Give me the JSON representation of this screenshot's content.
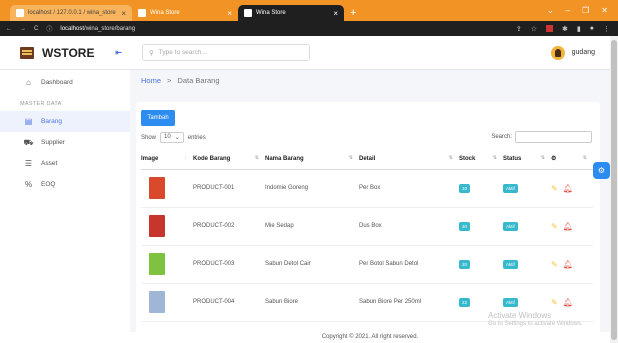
{
  "browser": {
    "tabs": [
      {
        "label": "localhost / 127.0.0.1 / wina_store"
      },
      {
        "label": "Wina Store"
      },
      {
        "label": "Wina Store"
      }
    ],
    "url_prefix": "localhost",
    "url_path": "/wina_store/barang"
  },
  "app": {
    "brand": "WSTORE",
    "search_placeholder": "Type to search...",
    "username": "gudang"
  },
  "sidebar": {
    "dashboard": "Dashboard",
    "section": "MASTER DATA",
    "items": [
      {
        "label": "Barang"
      },
      {
        "label": "Supplier"
      },
      {
        "label": "Asset"
      },
      {
        "label": "EOQ"
      }
    ]
  },
  "breadcrumb": {
    "home": "Home",
    "sep": ">",
    "current": "Data Barang"
  },
  "table": {
    "add_button": "Tambah",
    "show": "Show",
    "entries_value": "10",
    "entries": "entries",
    "search_label": "Search:",
    "headers": [
      "Image",
      "Kode Barang",
      "Nama Barang",
      "Detail",
      "Stock",
      "Status"
    ],
    "rows": [
      {
        "code": "PRODUCT-001",
        "name": "Indomie Goreng",
        "detail": "Per Box",
        "stock": "10",
        "status": "Aktif",
        "thumb_color": "#d9492b"
      },
      {
        "code": "PRODUCT-002",
        "name": "Mie Sedap",
        "detail": "Dus Box",
        "stock": "20",
        "status": "Aktif",
        "thumb_color": "#c7362d"
      },
      {
        "code": "PRODUCT-003",
        "name": "Sabun Detol Cair",
        "detail": "Per Botol Sabun Detol",
        "stock": "20",
        "status": "Aktif",
        "thumb_color": "#7fc242"
      },
      {
        "code": "PRODUCT-004",
        "name": "Sabun Biore",
        "detail": "Sabun Biore Per 250ml",
        "stock": "22",
        "status": "Aktif",
        "thumb_color": "#9fb6d6"
      }
    ]
  },
  "footer": "Copyright © 2021. All right reserved.",
  "watermark": {
    "title": "Activate Windows",
    "sub": "Go to Settings to activate Windows."
  }
}
